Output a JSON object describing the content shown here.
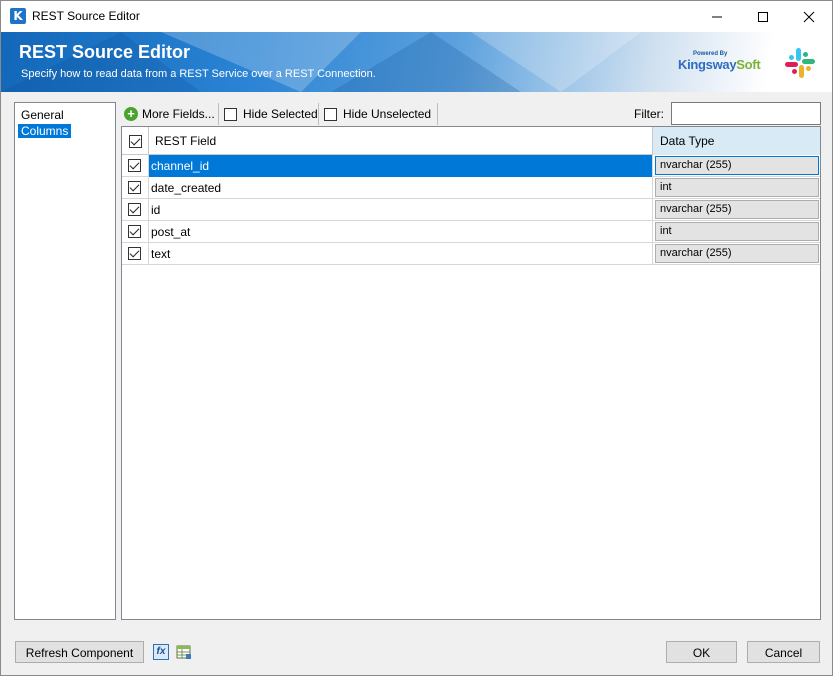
{
  "window": {
    "title": "REST Source Editor",
    "app_icon_letter": "K"
  },
  "banner": {
    "title": "REST Source Editor",
    "subtitle": "Specify how to read data from a REST Service over a REST Connection.",
    "powered_by": "Powered By",
    "brand_k": "K",
    "brand_ingsway": "ingsway",
    "brand_soft": "Soft"
  },
  "nav": {
    "items": [
      {
        "label": "General",
        "selected": false
      },
      {
        "label": "Columns",
        "selected": true
      }
    ]
  },
  "toolbar": {
    "more_fields": "More Fields...",
    "hide_selected": "Hide Selected",
    "hide_unselected": "Hide Unselected",
    "filter_label": "Filter:",
    "filter_value": ""
  },
  "grid": {
    "headers": {
      "field": "REST Field",
      "type": "Data Type"
    },
    "rows": [
      {
        "field": "channel_id",
        "type": "nvarchar (255)",
        "checked": true,
        "selected": true
      },
      {
        "field": "date_created",
        "type": "int",
        "checked": true,
        "selected": false
      },
      {
        "field": "id",
        "type": "nvarchar (255)",
        "checked": true,
        "selected": false
      },
      {
        "field": "post_at",
        "type": "int",
        "checked": true,
        "selected": false
      },
      {
        "field": "text",
        "type": "nvarchar (255)",
        "checked": true,
        "selected": false
      }
    ]
  },
  "footer": {
    "refresh": "Refresh Component",
    "fx_icon_label": "fx",
    "ok": "OK",
    "cancel": "Cancel"
  },
  "colors": {
    "accent": "#0078d7",
    "banner_blue": "#1267b8"
  }
}
